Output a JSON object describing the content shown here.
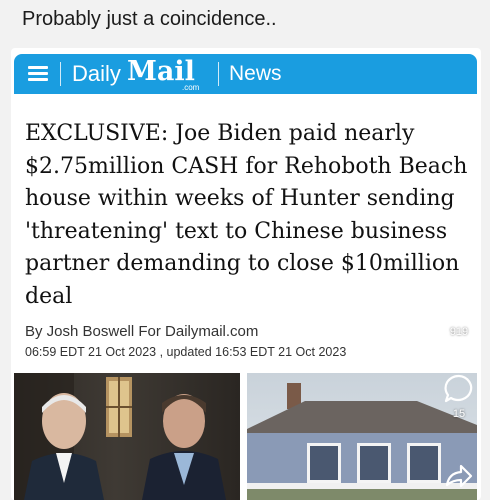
{
  "post": {
    "caption": "Probably just a coincidence.."
  },
  "header": {
    "brand_daily": "Daily",
    "brand_mail": "Mail",
    "brand_com": ".com",
    "section": "News",
    "bar_color": "#1a9de0"
  },
  "article": {
    "headline": "EXCLUSIVE: Joe Biden paid nearly $2.75million CASH for Rehoboth Beach house within weeks of Hunter sending 'threatening' text to Chinese business partner demanding to close $10million deal",
    "byline": "By Josh Boswell For Dailymail.com",
    "dateline": "06:59 EDT 21 Oct 2023 , updated 16:53 EDT 21 Oct 2023"
  },
  "actions": {
    "like_count": "919",
    "comment_count": "15",
    "like_icon": "thumbs-up-icon",
    "comment_icon": "speech-bubble-icon",
    "share_icon": "share-arrow-icon"
  }
}
